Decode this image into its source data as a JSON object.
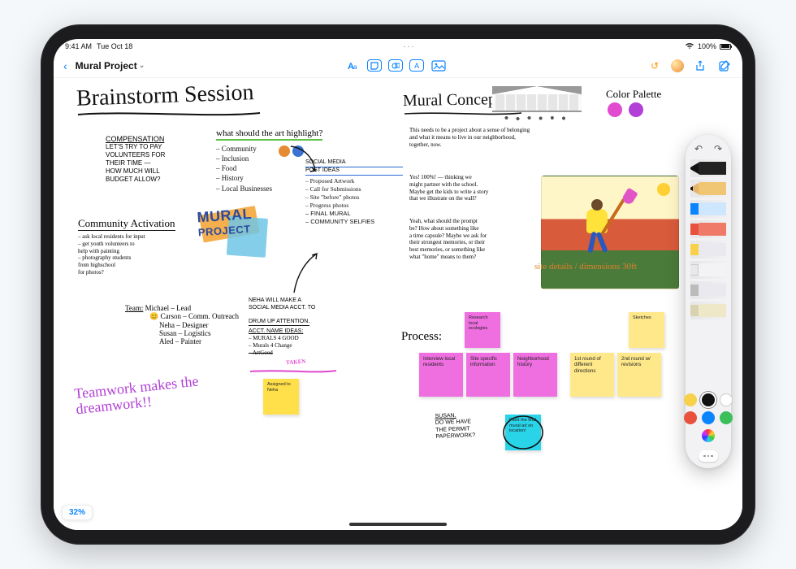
{
  "statusbar": {
    "time": "9:41 AM",
    "date": "Tue Oct 18",
    "center": "· · ·",
    "battery_pct": "100%"
  },
  "toolbar": {
    "back_glyph": "‹",
    "title": "Mural Project",
    "icons": [
      "text-style",
      "sticky-note",
      "shapes",
      "text-box",
      "media"
    ],
    "right": {
      "undo": "↺",
      "share": "􀈂",
      "compose": "✎"
    }
  },
  "canvas": {
    "title_left": "Brainstorm Session",
    "title_right": "Mural Concepts",
    "compensation": {
      "heading": "COMPENSATION",
      "lines": [
        "LET'S TRY TO PAY",
        "VOLUNTEERS FOR",
        "THEIR TIME —",
        "HOW MUCH WILL",
        "BUDGET ALLOW?"
      ]
    },
    "highlight_q": "what should the art highlight?",
    "highlight_items": [
      "Community",
      "Inclusion",
      "Food",
      "History",
      "Local Businesses"
    ],
    "social_heading": [
      "SOCIAL MEDIA",
      "POST IDEAS"
    ],
    "social_items": [
      "Proposed Artwork",
      "Call for Submissions",
      "Site \"before\" photos",
      "Progress photos",
      "FINAL MURAL",
      "COMMUNITY SELFIES"
    ],
    "activation": {
      "heading": "Community Activation",
      "lines": [
        "– ask local residents for input",
        "– get youth volunteers to",
        "  help with painting",
        "– photography students",
        "  from highschool",
        "  for photos?"
      ]
    },
    "mural_logo": [
      "MURAL",
      "PROJECT"
    ],
    "team": {
      "heading": "Team:",
      "members": [
        "Michael – Lead",
        "Carson – Comm. Outreach",
        "Neha – Designer",
        "Susan – Logistics",
        "Aled – Painter"
      ]
    },
    "neha_block": {
      "a": [
        "NEHA WILL MAKE A",
        "SOCIAL MEDIA ACCT. TO",
        "DRUM UP ATTENTION."
      ],
      "b_head": "ACCT. NAME IDEAS:",
      "b": [
        "– MURALS 4 GOOD",
        "– Murals 4 Change",
        "– ArtGood"
      ],
      "taken": "TAKEN"
    },
    "teamwork": "Teamwork makes the dreamwork!!",
    "sticky_assigned": "Assigned to Neha",
    "right_text": {
      "needs": "This needs to be a project about a sense of belonging and what it means to live in our neighborhood, together, now.",
      "yes": [
        "Yes! 100%! — thinking we",
        "might partner with the school.",
        "Maybe get the kids to write a story",
        "that we illustrate on the wall?"
      ],
      "yeah": [
        "Yeah, what should the prompt",
        "be? How about something like",
        "a time capsule? Maybe we ask for",
        "their strongest memories, or their",
        "best memories, or something like",
        "what \"home\" means to them?"
      ]
    },
    "site_note": "site details / dimensions 30ft",
    "palette_label": "Color Palette",
    "process_label": "Process:",
    "stickies_row1": [
      "Research local ecologies",
      "Sketches"
    ],
    "stickies_row2": [
      "Interview local residents",
      "Site specific information",
      "Neighborhood history",
      "1st round of different directions",
      "2nd round w/ revisions"
    ],
    "susan_note": [
      "SUSAN,",
      "DO WE HAVE",
      "THE PERMIT",
      "PAPERWORK?"
    ],
    "susan_sticky": "Paint the final mural art on location!",
    "zoom": "32%"
  },
  "palette": {
    "tools": [
      "pen",
      "pencil",
      "marker",
      "crayon",
      "brush",
      "eraser",
      "lasso",
      "ruler"
    ],
    "colors": [
      "#f7d14a",
      "#111111",
      "#ffffff",
      "#e8513d",
      "#0a84ff",
      "#3bbf5a"
    ],
    "swatches_top": [
      "#e04bcf",
      "#b23fd6"
    ]
  }
}
